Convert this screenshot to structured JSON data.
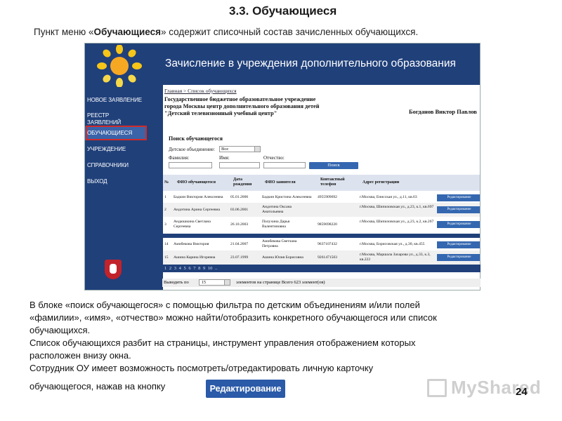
{
  "slide": {
    "title": "3.3. Обучающиеся",
    "intro_prefix": "Пункт меню «",
    "intro_bold": "Обучающиеся",
    "intro_suffix": "» содержит списочный состав зачисленных обучающихся.",
    "desc_lines": [
      "В блоке «поиск обучающегося» с помощью фильтра по детским объединениям  и/или полей",
      "«фамилии», «имя», «отчество» можно найти/отобразить конкретного обучающегося или список",
      "обучающихся.",
      "Список обучающихся разбит на страницы, инструмент управления отображением которых",
      "расположен внизу окна.",
      "Сотрудник ОУ имеет возможность посмотреть/отредактировать личную карточку"
    ],
    "last_line": "обучающегося, нажав на кнопку",
    "edit_button_label": "Редактирование",
    "watermark": "MyShared",
    "page_number": "24"
  },
  "app": {
    "banner_title": "Зачисление в учреждения дополнительного образования",
    "menu": [
      "Новое заявление",
      "Реестр заявлений",
      "Обучающиеся",
      "Учреждение",
      "Справочники",
      "Выход"
    ],
    "breadcrumb": "Главная > Список обучающихся",
    "org_name": "Государственное бюджетное образовательное учреждение города Москвы центр дополнительного образования детей \"Детский телевизионный учебный центр\"",
    "user_name": "Богданов Виктор Павлов",
    "search": {
      "title": "Поиск обучающегося",
      "group_label": "Детское объединение:",
      "group_value": "Все",
      "lastname_label": "Фамилия:",
      "firstname_label": "Имя:",
      "patronymic_label": "Отчество:",
      "button": "Поиск"
    },
    "table": {
      "headers": [
        "№",
        "ФИО обучающегося",
        "Дата рождения",
        "ФИО заявителя",
        "Контактный телефон",
        "Адрес регистрации"
      ],
      "rows": [
        {
          "n": "1",
          "student": "Бадкин Виктория Алексеевна",
          "dob": "05.01.2006",
          "applicant": "Бадкин Кристина Алексеевна",
          "phone": "4955909692",
          "address": "г.Москва, Енисская ул., д.11, кв.63",
          "action": "Редактирование"
        },
        {
          "n": "2",
          "student": "Андотина Арина Сергеевна",
          "dob": "03.06.2001",
          "applicant": "Андотина Оксана Анатольевна",
          "phone": "",
          "address": "г.Москва, Шипиловская ул., д.23, к.1, кв.697",
          "action": "Редактирование"
        },
        {
          "n": "3",
          "student": "Андюшкина Светлана Сергеевна",
          "dob": "26.10.2003",
          "applicant": "Полухина Дарья Валентиновна",
          "phone": "9859698220",
          "address": "г.Москва, Шипиловская ул., д.23, к.2, кв.267",
          "action": "Редактирование"
        },
        {
          "n": "14",
          "student": "Амибекова Виктория",
          "dob": "21.04.2007",
          "applicant": "Амибекова Светлана Петровна",
          "phone": "9637107432",
          "address": "г.Москва, Борисовская ул., д.30, кв.455",
          "action": "Редактирование"
        },
        {
          "n": "15",
          "student": "Ашина Карина Игоревна",
          "dob": "23.07.1999",
          "applicant": "Ашина Юлия Борисовна",
          "phone": "9261471503",
          "address": "г.Москва, Маршала Захарова ул., д.33, к.3, кв.222",
          "action": "Редактирование"
        }
      ]
    },
    "pager": "1  2  3  4  5  6  7  8  9  10  ..",
    "per_page": {
      "label": "Выводить по",
      "value": "15",
      "suffix": "элементов на странице  Всего 623 элемент(ов)"
    }
  },
  "colors": {
    "header_blue": "#20407a",
    "button_blue": "#3467b0",
    "highlight_red": "#d12a2a",
    "sun_yellow": "#f5c518"
  }
}
